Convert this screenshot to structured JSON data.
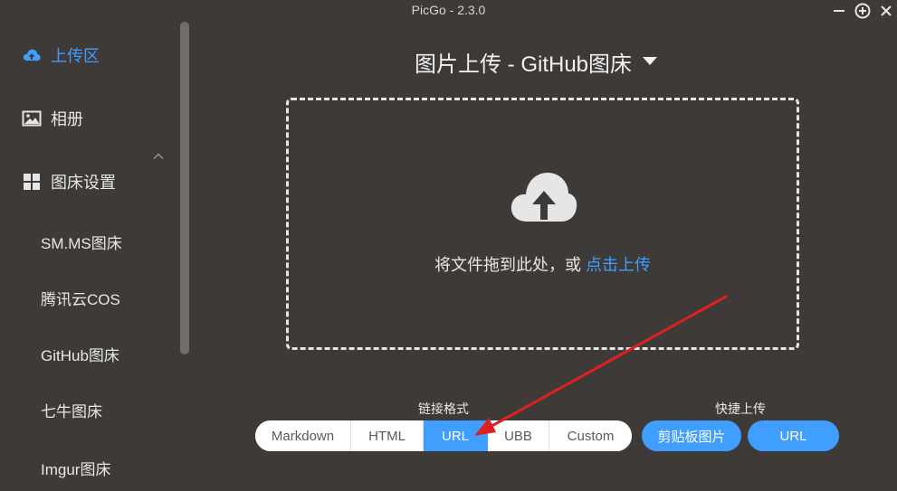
{
  "window": {
    "title": "PicGo - 2.3.0"
  },
  "sidebar": {
    "items": [
      {
        "label": "上传区",
        "icon": "upload-cloud-icon",
        "active": true
      },
      {
        "label": "相册",
        "icon": "image-icon",
        "active": false
      },
      {
        "label": "图床设置",
        "icon": "grid-icon",
        "active": false
      }
    ],
    "sub_items": [
      {
        "label": "SM.MS图床"
      },
      {
        "label": "腾讯云COS"
      },
      {
        "label": "GitHub图床"
      },
      {
        "label": "七牛图床"
      },
      {
        "label": "Imgur图床"
      }
    ]
  },
  "main": {
    "heading": "图片上传 - GitHub图床",
    "dropzone": {
      "text": "将文件拖到此处，或",
      "link": "点击上传"
    },
    "link_format": {
      "label": "链接格式",
      "options": [
        "Markdown",
        "HTML",
        "URL",
        "UBB",
        "Custom"
      ],
      "selected": "URL"
    },
    "quick_upload": {
      "label": "快捷上传",
      "buttons": [
        "剪贴板图片",
        "URL"
      ]
    }
  },
  "colors": {
    "accent": "#409eff",
    "background": "#3d3a37",
    "annotation_arrow": "#e02020"
  }
}
